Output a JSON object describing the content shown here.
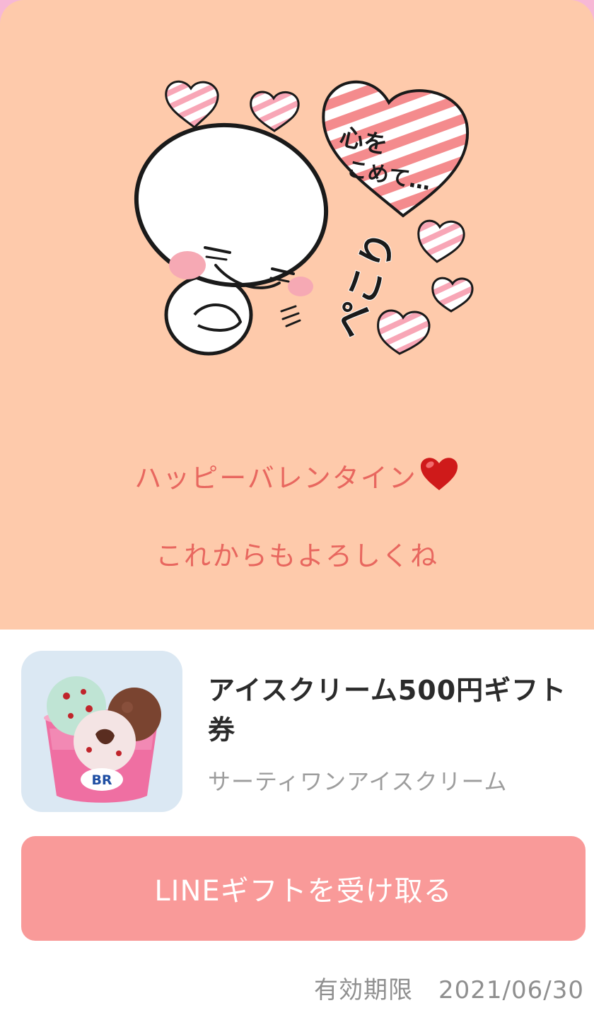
{
  "message": {
    "line1": "ハッピーバレンタイン",
    "line1_emoji": "heart-emoji",
    "line2": "これからもよろしくね"
  },
  "sticker": {
    "heart_text_top": "心を",
    "heart_text_bottom": "こめて…",
    "side_text": "ペこり",
    "icon": "bowing-character-sticker"
  },
  "product": {
    "title": "アイスクリーム500円ギフト券",
    "brand": "サーティワンアイスクリーム",
    "image_icon": "ice-cream-cup",
    "logo_text": "BR"
  },
  "cta": {
    "label": "LINEギフトを受け取る"
  },
  "expiry": {
    "label": "有効期限",
    "date": "2021/06/30"
  },
  "colors": {
    "hero_bg": "#fecaab",
    "message": "#e8675f",
    "cta_bg": "#f99a99",
    "title": "#2b2b2b",
    "sub": "#9d9d9d"
  }
}
